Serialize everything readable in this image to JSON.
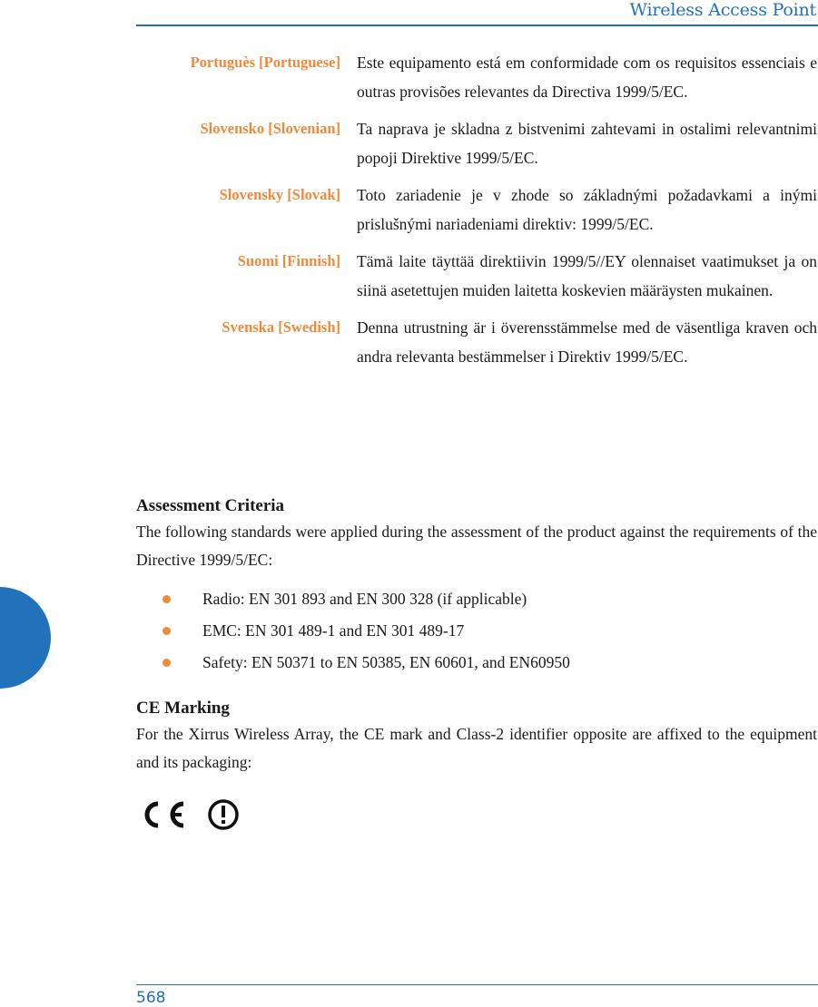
{
  "header": {
    "title": "Wireless Access Point"
  },
  "languages": [
    {
      "label": "Portuguès [Portuguese]",
      "text": "Este equipamento está em conformidade com os requisitos essenciais e outras provisões relevantes da Directiva 1999/5/EC."
    },
    {
      "label": "Slovensko [Slovenian]",
      "text": "Ta naprava je skladna z bistvenimi zahtevami in ostalimi relevantnimi popoji Direktive 1999/5/EC."
    },
    {
      "label": "Slovensky [Slovak]",
      "text": "Toto zariadenie je v zhode so základnými požadavkami a inými prislušnými nariadeniami direktiv: 1999/5/EC."
    },
    {
      "label": "Suomi [Finnish]",
      "text": "Tämä laite täyttää direktiivin 1999/5//EY olennaiset vaatimukset ja on siinä asetettujen muiden laitetta koskevien määräysten mukainen."
    },
    {
      "label": "Svenska [Swedish]",
      "text": "Denna utrustning är i överensstämmelse med de väsentliga kraven och andra relevanta bestämmelser i Direktiv 1999/5/EC."
    }
  ],
  "assessment": {
    "heading": "Assessment Criteria",
    "intro": "The following standards were applied during the assessment of the product against the requirements of the Directive 1999/5/EC:",
    "items": [
      "Radio: EN 301 893 and EN 300 328 (if applicable)",
      "EMC: EN 301 489-1 and EN 301 489-17",
      "Safety: EN 50371 to EN 50385, EN 60601, and EN60950"
    ]
  },
  "ce_marking": {
    "heading": "CE Marking",
    "text": "For the Xirrus Wireless Array, the CE mark and Class-2 identifier opposite are affixed to the equipment and its packaging:",
    "marks": [
      "ce-mark-icon",
      "class-2-alert-icon"
    ]
  },
  "footer": {
    "page_number": "568"
  },
  "colors": {
    "accent_blue": "#2171b8",
    "label_orange": "#f08a3a"
  }
}
